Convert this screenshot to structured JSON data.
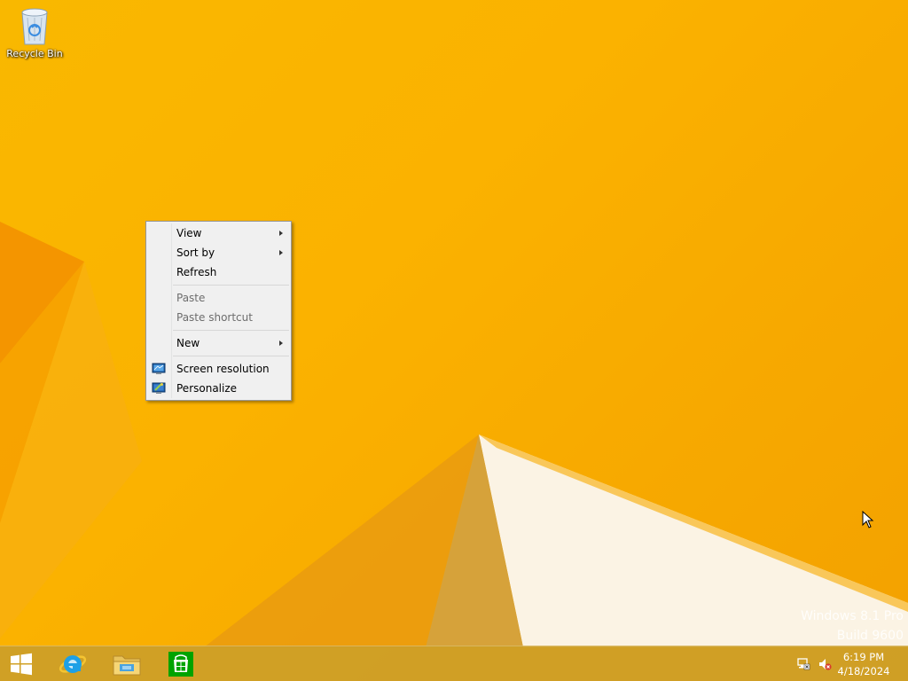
{
  "desktop": {
    "icons": [
      {
        "label": "Recycle Bin",
        "icon": "recycle-bin-icon"
      }
    ]
  },
  "context_menu": {
    "items": [
      {
        "label": "View",
        "submenu": true,
        "disabled": false
      },
      {
        "label": "Sort by",
        "submenu": true,
        "disabled": false
      },
      {
        "label": "Refresh",
        "submenu": false,
        "disabled": false
      },
      {
        "label": "Paste",
        "submenu": false,
        "disabled": true
      },
      {
        "label": "Paste shortcut",
        "submenu": false,
        "disabled": true
      },
      {
        "label": "New",
        "submenu": true,
        "disabled": false
      },
      {
        "label": "Screen resolution",
        "submenu": false,
        "disabled": false,
        "icon": "display-icon"
      },
      {
        "label": "Personalize",
        "submenu": false,
        "disabled": false,
        "icon": "personalize-icon"
      }
    ]
  },
  "watermark": {
    "line1": "Windows 8.1 Pro",
    "line2": "Build 9600"
  },
  "taskbar": {
    "pinned": [
      {
        "icon": "windows-start-icon"
      },
      {
        "icon": "internet-explorer-icon"
      },
      {
        "icon": "file-explorer-icon"
      },
      {
        "icon": "windows-store-icon"
      }
    ],
    "tray": {
      "network_icon": "network-icon",
      "volume_icon": "volume-muted-icon"
    },
    "clock": {
      "time": "6:19 PM",
      "date": "4/18/2024"
    }
  },
  "colors": {
    "wallpaper": "#f9b800",
    "taskbar": "#cc9e28",
    "store_green": "#00a300"
  }
}
